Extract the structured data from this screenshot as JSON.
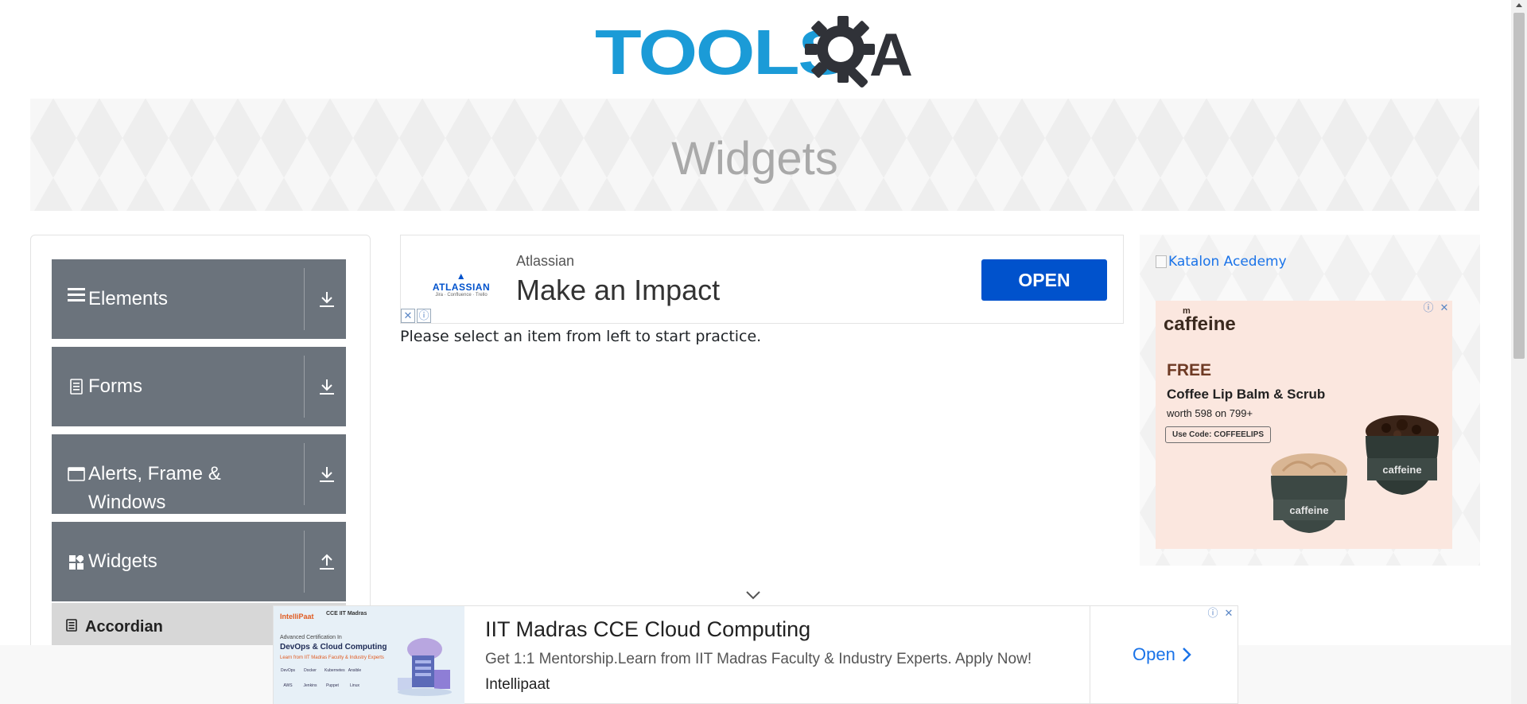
{
  "header": {
    "logo_text": "TOOLS",
    "logo_suffix": "A",
    "logo_brand": "TOOLSQA"
  },
  "banner": {
    "title": "Widgets"
  },
  "sidebar": {
    "groups": [
      {
        "label": "Elements",
        "icon": "hamburger-icon",
        "arrow": "download-arrow-icon"
      },
      {
        "label": "Forms",
        "icon": "form-document-icon",
        "arrow": "download-arrow-icon"
      },
      {
        "label": "Alerts, Frame & Windows",
        "icon": "window-icon",
        "arrow": "download-arrow-icon"
      },
      {
        "label": "Widgets",
        "icon": "widgets-grid-icon",
        "arrow": "upload-arrow-icon"
      }
    ],
    "sub_items": [
      {
        "label": "Accordian",
        "icon": "list-doc-icon"
      }
    ]
  },
  "center_ad": {
    "logo_brand": "ATLASSIAN",
    "logo_tagline": "Jira · Confluence · Trello",
    "advertiser": "Atlassian",
    "headline": "Make an Impact",
    "cta": "OPEN",
    "close_glyph": "✕",
    "info_glyph": "ⓘ"
  },
  "main": {
    "prompt": "Please select an item from left to start practice."
  },
  "right_ad": {
    "link_alt": "Katalon Acedemy",
    "card": {
      "brand": "caffeine",
      "brand_prefix": "m",
      "free": "FREE",
      "product": "Coffee Lip Balm & Scrub",
      "worth": "worth 598 on 799+",
      "code": "Use Code: COFFEELIPS",
      "jar_label": "caffeine"
    },
    "info_glyph": "ⓘ",
    "close_glyph": "✕"
  },
  "bottom_ad": {
    "thumb": {
      "brand": "IntelliPaat",
      "partner": "CCE IIT Madras",
      "line1": "Advanced Certification In",
      "line2": "DevOps & Cloud Computing",
      "line3": "Learn from IIT Madras Faculty & Industry Experts",
      "tools": [
        "DevOps",
        "Docker",
        "Kubernetes",
        "Ansible",
        "AWS",
        "Jenkins",
        "Puppet",
        "Linux"
      ]
    },
    "title": "IIT Madras CCE Cloud Computing",
    "description": "Get 1:1 Mentorship.Learn from IIT Madras Faculty & Industry Experts. Apply Now!",
    "advertiser": "Intellipaat",
    "cta": "Open",
    "info_glyph": "ⓘ",
    "close_glyph": "✕"
  },
  "colors": {
    "logo_blue": "#1b9bd7",
    "logo_dark": "#303238",
    "sidebar_group": "#6b737c",
    "sub_item_bg": "#d7d7d7",
    "atlassian_blue": "#0052cc",
    "link_blue": "#1a73e8"
  }
}
